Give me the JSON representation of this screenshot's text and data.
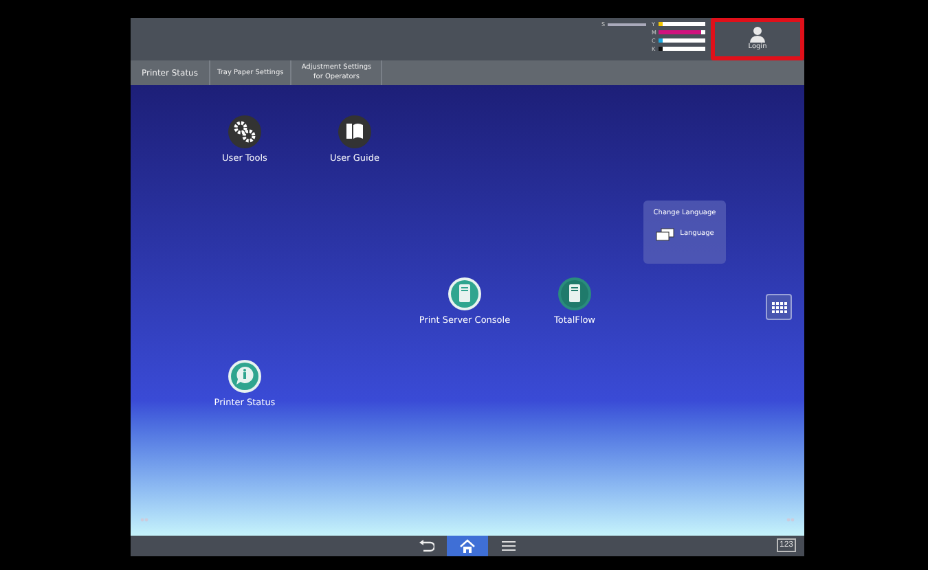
{
  "toner": {
    "waste_label": "S",
    "colors": [
      {
        "label": "Y",
        "color": "#f2c500",
        "level": 0.08
      },
      {
        "label": "M",
        "color": "#d0127e",
        "level": 0.9
      },
      {
        "label": "C",
        "color": "#1aa9e0",
        "level": 0.08
      },
      {
        "label": "K",
        "color": "#111111",
        "level": 0.08
      }
    ]
  },
  "login": {
    "label": "Login",
    "highlighted": true
  },
  "tabs": [
    {
      "label": "Printer Status"
    },
    {
      "label": "Tray Paper Settings"
    },
    {
      "label": "Adjustment Settings for Operators"
    }
  ],
  "apps": [
    {
      "label": "User Tools",
      "kind": "tools"
    },
    {
      "label": "User Guide",
      "kind": "guide"
    },
    {
      "label": "Print Server Console",
      "kind": "console"
    },
    {
      "label": "TotalFlow",
      "kind": "totalflow"
    },
    {
      "label": "Printer Status",
      "kind": "status"
    }
  ],
  "language_widget": {
    "title": "Change Language",
    "button": "Language"
  },
  "bottom_bar": {
    "items": [
      {
        "kind": "back",
        "selected": false
      },
      {
        "kind": "home",
        "selected": true
      },
      {
        "kind": "menu",
        "selected": false
      }
    ],
    "counter": "123"
  }
}
